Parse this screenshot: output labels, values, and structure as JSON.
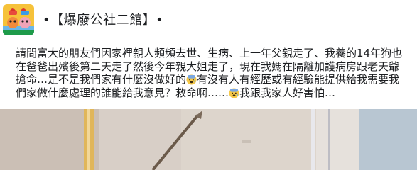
{
  "group": {
    "name": "•【爆廢公社二館】•",
    "avatar_icon": "cartoon-group-logo"
  },
  "post": {
    "text_part1": "請問富大的朋友們因家裡親人頻頻去世、生病、上一年父親走了、我養的14年狗也在爸爸出殯後第二天走了然後今年親大姐走了，現在我媽在隔離加護病房跟老天爺搶命…是不是我們家有什麼沒做好的",
    "text_part2": "有沒有人有經歷或有經驗能提供給我需要我們家做什麼處理的誰能給我意見？救命啊……",
    "text_part3": "我跟我家人好害怕…",
    "emoji_icon": "anxious-face-emoji"
  },
  "photo": {
    "description_icon": "room-interior-photo"
  }
}
